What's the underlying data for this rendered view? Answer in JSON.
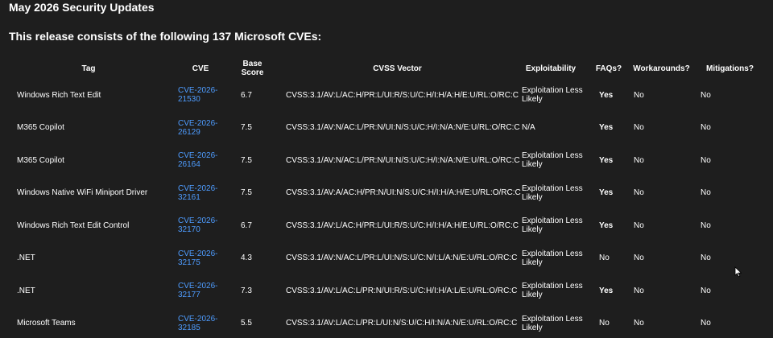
{
  "page": {
    "title": "May 2026 Security Updates",
    "subtitle": "This release consists of the following 137 Microsoft CVEs:"
  },
  "table": {
    "headers": {
      "tag": "Tag",
      "cve": "CVE",
      "base_score": "Base Score",
      "vector": "CVSS Vector",
      "exploitability": "Exploitability",
      "faqs": "FAQs?",
      "workarounds": "Workarounds?",
      "mitigations": "Mitigations?"
    },
    "rows": [
      {
        "tag": "Windows Rich Text Edit",
        "cve": "CVE-2026-21530",
        "score": "6.7",
        "vector": "CVSS:3.1/AV:L/AC:H/PR:L/UI:R/S:U/C:H/I:H/A:H/E:U/RL:O/RC:C",
        "exploitability": "Exploitation Less Likely",
        "faqs": "Yes",
        "workarounds": "No",
        "mitigations": "No"
      },
      {
        "tag": "M365 Copilot",
        "cve": "CVE-2026-26129",
        "score": "7.5",
        "vector": "CVSS:3.1/AV:N/AC:L/PR:N/UI:N/S:U/C:H/I:N/A:N/E:U/RL:O/RC:C",
        "exploitability": "N/A",
        "faqs": "Yes",
        "workarounds": "No",
        "mitigations": "No"
      },
      {
        "tag": "M365 Copilot",
        "cve": "CVE-2026-26164",
        "score": "7.5",
        "vector": "CVSS:3.1/AV:N/AC:L/PR:N/UI:N/S:U/C:H/I:N/A:N/E:U/RL:O/RC:C",
        "exploitability": "Exploitation Less Likely",
        "faqs": "Yes",
        "workarounds": "No",
        "mitigations": "No"
      },
      {
        "tag": "Windows Native WiFi Miniport Driver",
        "cve": "CVE-2026-32161",
        "score": "7.5",
        "vector": "CVSS:3.1/AV:A/AC:H/PR:N/UI:N/S:U/C:H/I:H/A:H/E:U/RL:O/RC:C",
        "exploitability": "Exploitation Less Likely",
        "faqs": "Yes",
        "workarounds": "No",
        "mitigations": "No"
      },
      {
        "tag": "Windows Rich Text Edit Control",
        "cve": "CVE-2026-32170",
        "score": "6.7",
        "vector": "CVSS:3.1/AV:L/AC:H/PR:L/UI:R/S:U/C:H/I:H/A:H/E:U/RL:O/RC:C",
        "exploitability": "Exploitation Less Likely",
        "faqs": "Yes",
        "workarounds": "No",
        "mitigations": "No"
      },
      {
        "tag": ".NET",
        "cve": "CVE-2026-32175",
        "score": "4.3",
        "vector": "CVSS:3.1/AV:N/AC:L/PR:L/UI:N/S:U/C:N/I:L/A:N/E:U/RL:O/RC:C",
        "exploitability": "Exploitation Less Likely",
        "faqs": "No",
        "workarounds": "No",
        "mitigations": "No"
      },
      {
        "tag": ".NET",
        "cve": "CVE-2026-32177",
        "score": "7.3",
        "vector": "CVSS:3.1/AV:L/AC:L/PR:N/UI:R/S:U/C:H/I:H/A:L/E:U/RL:O/RC:C",
        "exploitability": "Exploitation Less Likely",
        "faqs": "Yes",
        "workarounds": "No",
        "mitigations": "No"
      },
      {
        "tag": "Microsoft Teams",
        "cve": "CVE-2026-32185",
        "score": "5.5",
        "vector": "CVSS:3.1/AV:L/AC:L/PR:L/UI:N/S:U/C:H/I:N/A:N/E:U/RL:O/RC:C",
        "exploitability": "Exploitation Less Likely",
        "faqs": "No",
        "workarounds": "No",
        "mitigations": "No"
      }
    ]
  },
  "icons": {
    "cursor": "mouse-pointer-icon"
  },
  "colors": {
    "background": "#1e1e1e",
    "text": "#ffffff",
    "link": "#4e9cff"
  }
}
